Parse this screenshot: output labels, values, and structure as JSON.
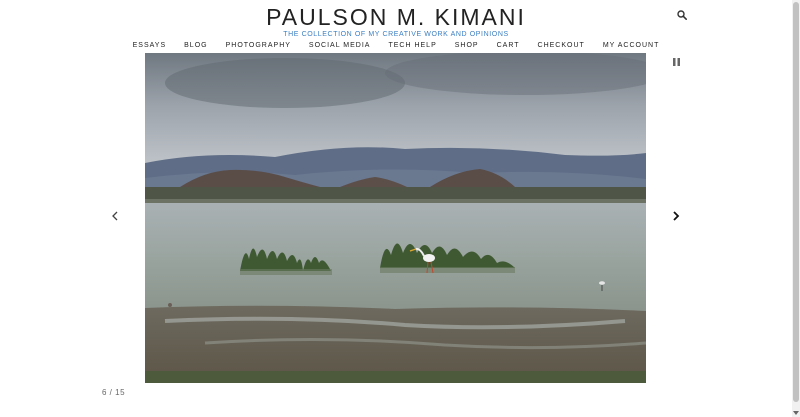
{
  "site": {
    "title": "PAULSON M. KIMANI",
    "tagline": "THE COLLECTION OF MY CREATIVE WORK AND OPINIONS"
  },
  "nav": {
    "items": [
      "ESSAYS",
      "BLOG",
      "PHOTOGRAPHY",
      "SOCIAL MEDIA",
      "TECH HELP",
      "SHOP",
      "CART",
      "CHECKOUT",
      "MY ACCOUNT"
    ]
  },
  "slideshow": {
    "counter": "6 / 15",
    "current": 6,
    "total": 15
  },
  "icons": {
    "search": "search-icon",
    "prev": "chevron-left-icon",
    "next": "chevron-right-icon",
    "pause": "pause-icon"
  },
  "colors": {
    "tagline": "#3b7fc4",
    "text": "#222222"
  }
}
